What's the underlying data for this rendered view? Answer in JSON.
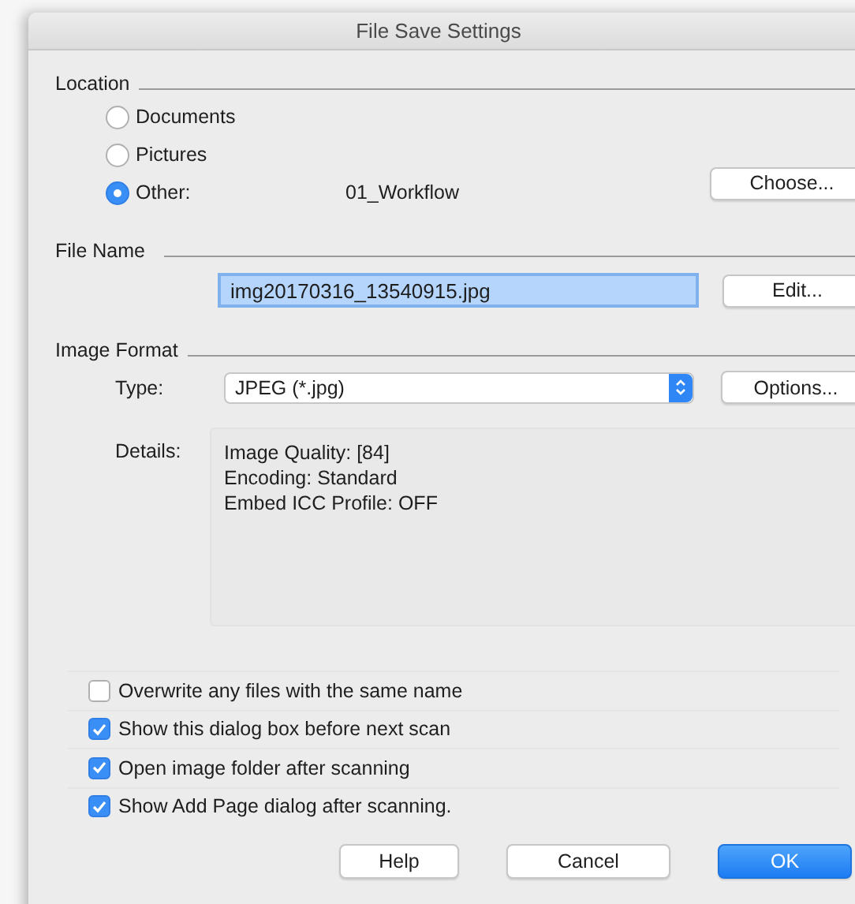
{
  "window": {
    "title": "File Save Settings"
  },
  "location": {
    "label": "Location",
    "options": [
      {
        "label": "Documents",
        "selected": false
      },
      {
        "label": "Pictures",
        "selected": false
      },
      {
        "label": "Other:",
        "selected": true
      }
    ],
    "folder": "01_Workflow",
    "button": "Choose..."
  },
  "file_name": {
    "label": "File Name",
    "value": "img20170316_13540915.jpg",
    "button": "Edit..."
  },
  "image_format": {
    "label": "Image Format",
    "type_label": "Type:",
    "type_value": "JPEG (*.jpg)",
    "button": "Options...",
    "details_label": "Details:",
    "details": [
      "Image Quality: [84]",
      "Encoding: Standard",
      "Embed ICC Profile: OFF"
    ]
  },
  "options": [
    {
      "label": "Overwrite any files with the same name",
      "checked": false
    },
    {
      "label": "Show this dialog box before next scan",
      "checked": true
    },
    {
      "label": "Open image folder after scanning",
      "checked": true
    },
    {
      "label": "Show Add Page dialog after scanning.",
      "checked": true
    }
  ],
  "buttons": [
    {
      "label": "Help",
      "kind": "normal"
    },
    {
      "label": "Cancel",
      "kind": "normal"
    },
    {
      "label": "OK",
      "kind": "default"
    }
  ]
}
